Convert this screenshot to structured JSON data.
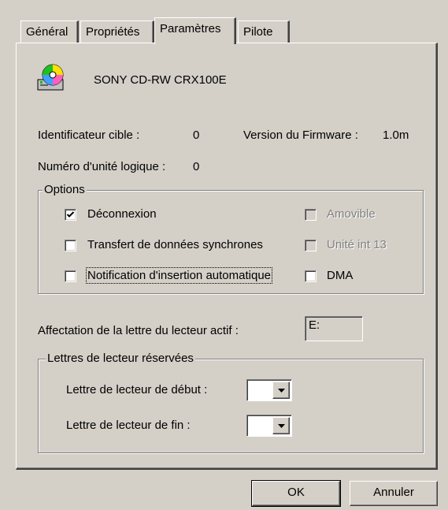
{
  "tabs": [
    {
      "label": "Général",
      "active": false
    },
    {
      "label": "Propriétés",
      "active": false
    },
    {
      "label": "Paramètres",
      "active": true
    },
    {
      "label": "Pilote",
      "active": false
    }
  ],
  "device": {
    "name": "SONY CD-RW  CRX100E",
    "icon": "cd-drive-icon"
  },
  "info": {
    "target_id_label": "Identificateur cible :",
    "target_id_value": "0",
    "firmware_label": "Version du Firmware :",
    "firmware_value": "1.0m",
    "lun_label": "Numéro d'unité logique :",
    "lun_value": "0"
  },
  "options": {
    "title": "Options",
    "disconnect": {
      "label": "Déconnexion",
      "checked": true,
      "enabled": true
    },
    "sync_transfer": {
      "label": "Transfert de données synchrones",
      "checked": false,
      "enabled": true
    },
    "auto_insert": {
      "label": "Notification d'insertion automatique",
      "checked": false,
      "enabled": true
    },
    "removable": {
      "label": "Amovible",
      "checked": false,
      "enabled": false
    },
    "int13": {
      "label": "Unité int 13",
      "checked": false,
      "enabled": false
    },
    "dma": {
      "label": "DMA",
      "checked": false,
      "enabled": true
    }
  },
  "drive_letter": {
    "label": "Affectation de la lettre du lecteur actif :",
    "value": "E:"
  },
  "reserved": {
    "title": "Lettres de lecteur réservées",
    "start_label": "Lettre de lecteur de début :",
    "start_value": "",
    "end_label": "Lettre de lecteur de fin :",
    "end_value": ""
  },
  "buttons": {
    "ok": "OK",
    "cancel": "Annuler"
  }
}
